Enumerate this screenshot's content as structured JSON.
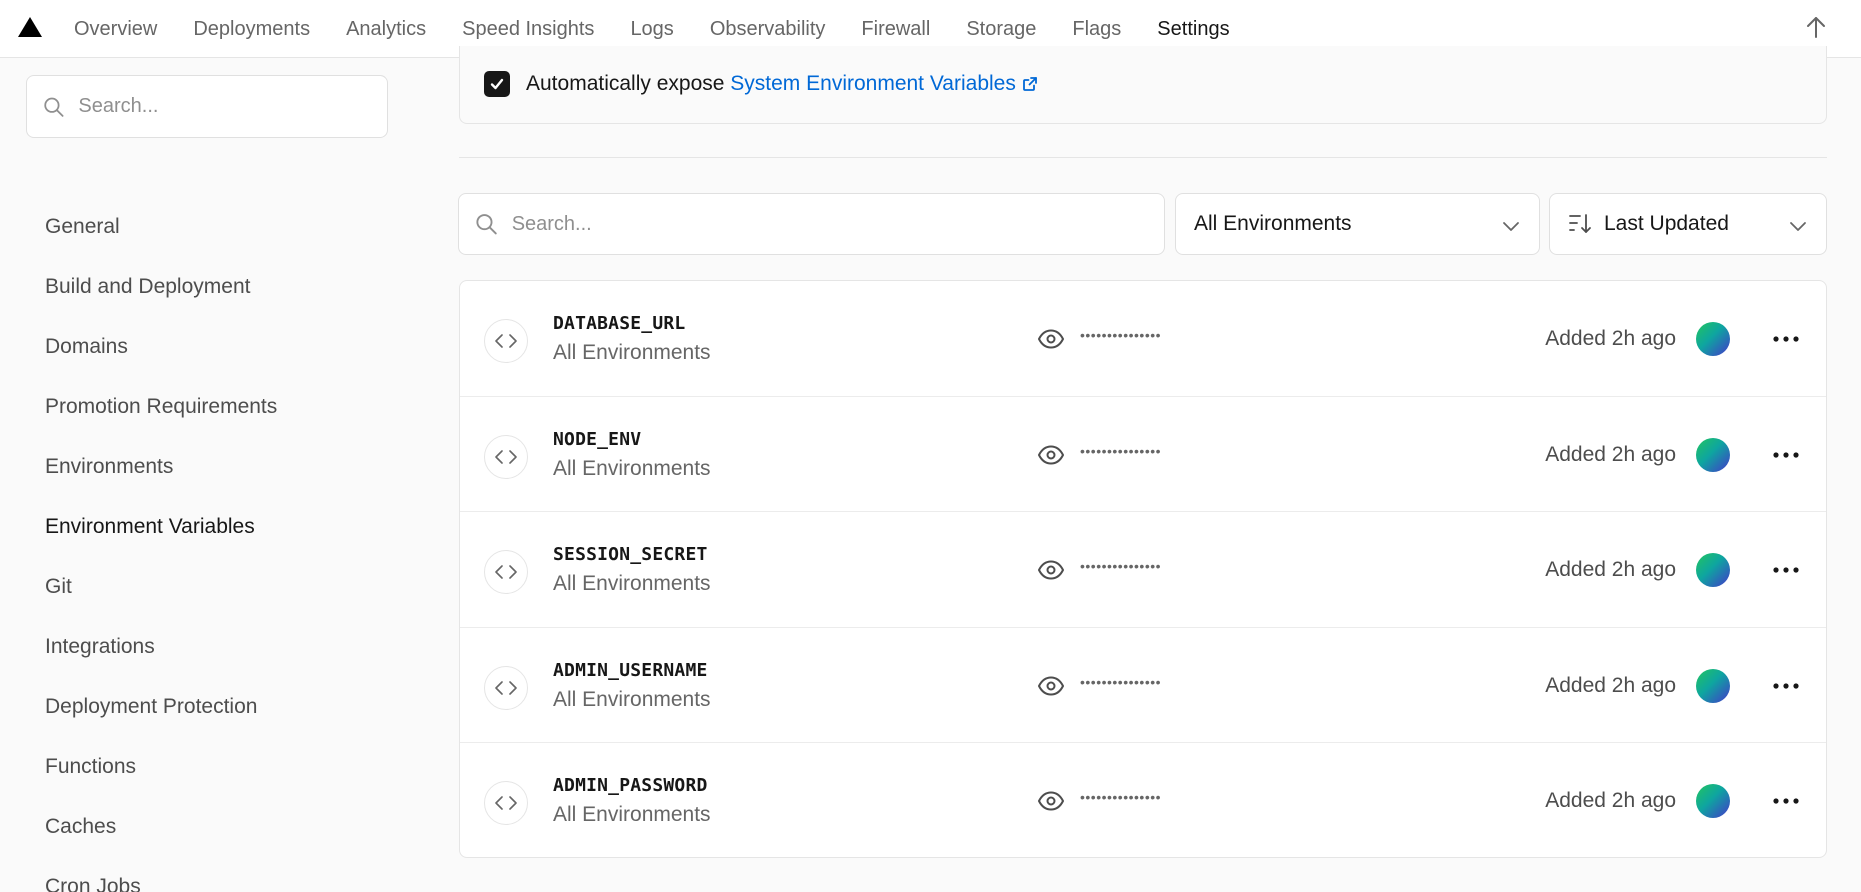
{
  "nav": {
    "logo_icon": "vercel-triangle-icon",
    "tabs": [
      {
        "label": "Overview"
      },
      {
        "label": "Deployments"
      },
      {
        "label": "Analytics"
      },
      {
        "label": "Speed Insights"
      },
      {
        "label": "Logs"
      },
      {
        "label": "Observability"
      },
      {
        "label": "Firewall"
      },
      {
        "label": "Storage"
      },
      {
        "label": "Flags"
      },
      {
        "label": "Settings",
        "active": true
      }
    ],
    "right_icon": "arrow-up-icon"
  },
  "sidebar": {
    "search_placeholder": "Search...",
    "items": [
      {
        "label": "General"
      },
      {
        "label": "Build and Deployment"
      },
      {
        "label": "Domains"
      },
      {
        "label": "Promotion Requirements"
      },
      {
        "label": "Environments"
      },
      {
        "label": "Environment Variables",
        "active": true
      },
      {
        "label": "Git"
      },
      {
        "label": "Integrations"
      },
      {
        "label": "Deployment Protection"
      },
      {
        "label": "Functions"
      },
      {
        "label": "Caches"
      },
      {
        "label": "Cron Jobs"
      }
    ]
  },
  "expose": {
    "checked": true,
    "text": "Automatically expose",
    "link": "System Environment Variables"
  },
  "filters": {
    "search_placeholder": "Search...",
    "environment": "All Environments",
    "sort": "Last Updated"
  },
  "variables": [
    {
      "name": "DATABASE_URL",
      "environment": "All Environments",
      "value": "•••••••••••••••",
      "updated": "Added 2h ago"
    },
    {
      "name": "NODE_ENV",
      "environment": "All Environments",
      "value": "•••••••••••••••",
      "updated": "Added 2h ago"
    },
    {
      "name": "SESSION_SECRET",
      "environment": "All Environments",
      "value": "•••••••••••••••",
      "updated": "Added 2h ago"
    },
    {
      "name": "ADMIN_USERNAME",
      "environment": "All Environments",
      "value": "•••••••••••••••",
      "updated": "Added 2h ago"
    },
    {
      "name": "ADMIN_PASSWORD",
      "environment": "All Environments",
      "value": "•••••••••••••••",
      "updated": "Added 2h ago"
    }
  ],
  "colors": {
    "accent_link": "#0068d6",
    "text_primary": "#171717",
    "text_secondary": "#666666"
  }
}
